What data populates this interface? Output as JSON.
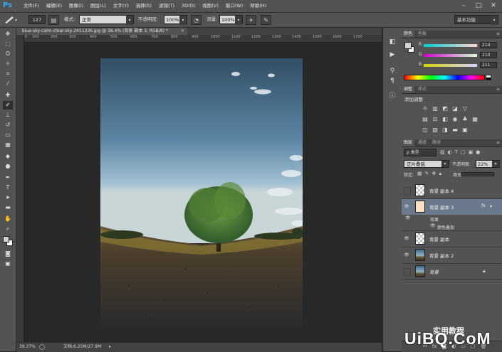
{
  "app": {
    "logo": "Ps"
  },
  "menu": [
    "文件(F)",
    "编辑(E)",
    "图像(I)",
    "图层(L)",
    "文字(Y)",
    "选择(S)",
    "滤镜(T)",
    "3D(D)",
    "视图(V)",
    "窗口(W)",
    "帮助(H)"
  ],
  "window_controls": {
    "minimize": "–",
    "maximize": "□",
    "close": "✕"
  },
  "options": {
    "brush_size": "127",
    "mode_label": "模式:",
    "mode_value": "正常",
    "opacity_label": "不透明度:",
    "opacity_value": "100%",
    "flow_label": "流量:",
    "flow_value": "100%",
    "workspace": "基本功能"
  },
  "document": {
    "tab_title": "blue-sky-calm-clear-sky-2451336.jpg @ 38.4% (背景 副本 3, RGB/8) *",
    "close": "×"
  },
  "ruler_h_ticks": [
    "0",
    "100",
    "200",
    "300",
    "400",
    "500",
    "600",
    "700",
    "800",
    "900",
    "1000",
    "1100",
    "1200",
    "1300",
    "1400",
    "1500",
    "1600",
    "1700"
  ],
  "status": {
    "zoom": "38.37%",
    "doc_info": "文档:6.25M/27.9M"
  },
  "color_panel": {
    "tabs": [
      "颜色",
      "色板"
    ],
    "channels": [
      {
        "label": "R",
        "value": "214"
      },
      {
        "label": "G",
        "value": "210"
      },
      {
        "label": "B",
        "value": "211"
      }
    ]
  },
  "adjustments_panel": {
    "tabs": [
      "调整",
      "样式"
    ],
    "title": "添加调整"
  },
  "layers_panel": {
    "tabs": [
      "图层",
      "通道",
      "路径"
    ],
    "filter_kind": "ρ 类型",
    "blend_mode": "正片叠底",
    "opacity_label": "不透明度:",
    "opacity_value": "22%",
    "lock_label": "锁定:",
    "fill_label": "填充:",
    "effects_label": "效果",
    "effect_item": "颜色叠加",
    "fx": "fx",
    "layers": [
      {
        "name": "背景 副本 4",
        "visible": false,
        "thumb": "checker"
      },
      {
        "name": "背景 副本 3",
        "visible": true,
        "thumb": "photo",
        "selected": true
      },
      {
        "name": "背景 副本",
        "visible": true,
        "thumb": "checker"
      },
      {
        "name": "背景 副本 2",
        "visible": true,
        "thumb": "photo"
      },
      {
        "name": "背景",
        "visible": false,
        "thumb": "photo",
        "locked": true
      }
    ]
  },
  "watermark": {
    "text": "UiBQ.CoM",
    "caption": "实用教程"
  },
  "colors": {
    "ui_bg": "#535353",
    "canvas_bg": "#282828",
    "selected_layer": "#6a7a8c",
    "ps_blue": "#31a8ff"
  }
}
